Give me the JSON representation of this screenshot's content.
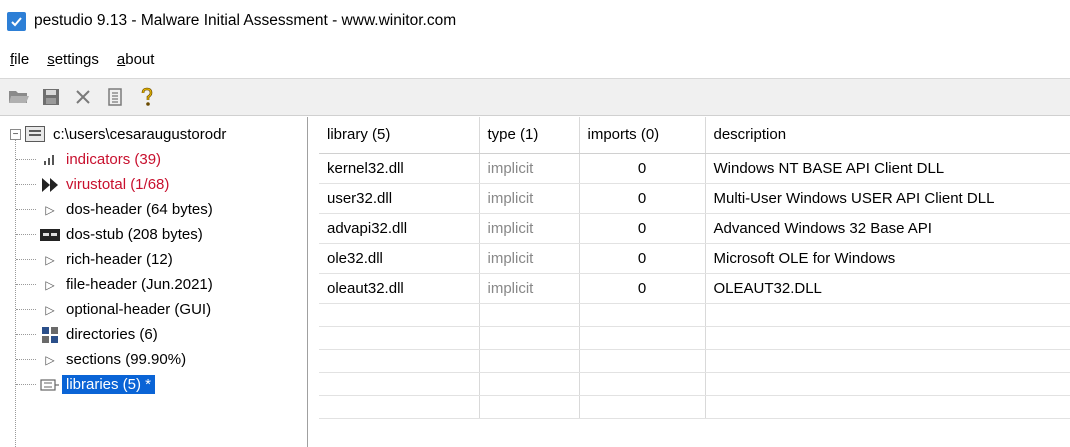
{
  "window": {
    "title": "pestudio 9.13 - Malware Initial Assessment - www.winitor.com"
  },
  "menu": [
    {
      "label": "file",
      "accel": "f",
      "rest": "ile"
    },
    {
      "label": "settings",
      "accel": "s",
      "rest": "ettings"
    },
    {
      "label": "about",
      "accel": "a",
      "rest": "bout"
    }
  ],
  "toolbar": {
    "icons": [
      "open-folder-icon",
      "save-icon",
      "close-icon",
      "document-icon",
      "help-icon"
    ]
  },
  "tree": {
    "root": "c:\\users\\cesaraugustorodr",
    "items": [
      {
        "label": "indicators (39)",
        "color": "#c8102e",
        "icon": "bars-icon"
      },
      {
        "label": "virustotal (1/68)",
        "color": "#c8102e",
        "icon": "virustotal-icon"
      },
      {
        "label": "dos-header (64 bytes)",
        "icon": "triangle-icon"
      },
      {
        "label": "dos-stub (208 bytes)",
        "icon": "terminal-icon"
      },
      {
        "label": "rich-header (12)",
        "icon": "triangle-icon"
      },
      {
        "label": "file-header (Jun.2021)",
        "icon": "triangle-icon"
      },
      {
        "label": "optional-header (GUI)",
        "icon": "triangle-icon"
      },
      {
        "label": "directories (6)",
        "icon": "grid-icon"
      },
      {
        "label": "sections (99.90%)",
        "icon": "triangle-icon"
      },
      {
        "label": "libraries (5) *",
        "icon": "library-icon",
        "selected": true
      }
    ]
  },
  "table": {
    "columns": [
      "library (5)",
      "type (1)",
      "imports (0)",
      "description"
    ],
    "rows": [
      [
        "kernel32.dll",
        "implicit",
        "0",
        "Windows NT BASE API Client DLL"
      ],
      [
        "user32.dll",
        "implicit",
        "0",
        "Multi-User Windows USER API Client DLL"
      ],
      [
        "advapi32.dll",
        "implicit",
        "0",
        "Advanced Windows 32 Base API"
      ],
      [
        "ole32.dll",
        "implicit",
        "0",
        "Microsoft OLE for Windows"
      ],
      [
        "oleaut32.dll",
        "implicit",
        "0",
        "OLEAUT32.DLL"
      ]
    ]
  },
  "colors": {
    "accent": "#2d7fd6",
    "selection": "#0a64d6",
    "alert": "#c8102e"
  }
}
